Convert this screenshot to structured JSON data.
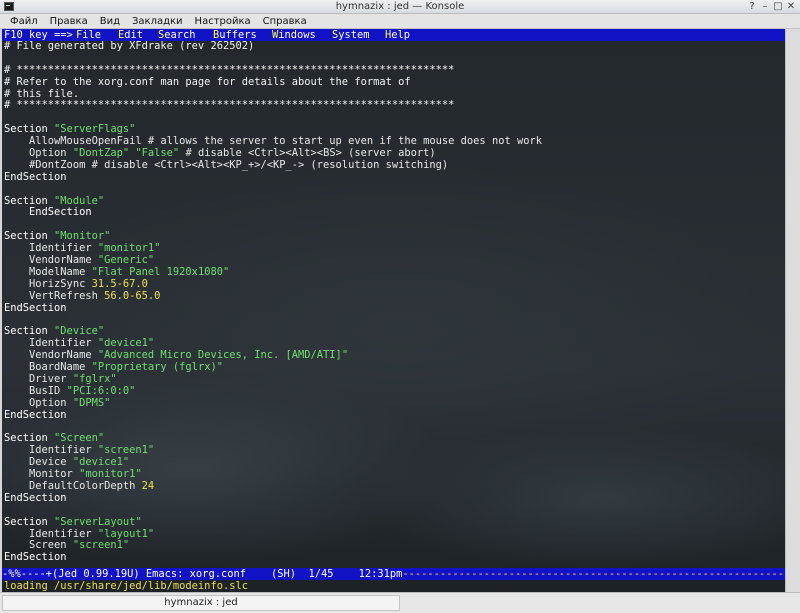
{
  "window": {
    "title": "hymnazix : jed — Konsole",
    "controls": [
      "?",
      "–",
      "□",
      "✕"
    ]
  },
  "menubar": {
    "items": [
      "Файл",
      "Правка",
      "Вид",
      "Закладки",
      "Настройка",
      "Справка"
    ]
  },
  "jed_menu": {
    "prefix": "F10 key ==>",
    "items": [
      {
        "hot": "F",
        "rest": "ile"
      },
      {
        "hot": "E",
        "rest": "dit"
      },
      {
        "hot": "S",
        "rest": "earch"
      },
      {
        "hot": "B",
        "rest": "uffers"
      },
      {
        "hot": "W",
        "rest": "indows"
      },
      {
        "hot": "S",
        "rest": "ystem"
      },
      {
        "hot": "H",
        "rest": "elp"
      }
    ]
  },
  "buffer_lines": [
    [
      [
        "comment",
        "# File generated by XFdrake (rev 262502)"
      ]
    ],
    [],
    [
      [
        "comment",
        "# **********************************************************************"
      ]
    ],
    [
      [
        "comment",
        "# Refer to the xorg.conf man page for details about the format of"
      ]
    ],
    [
      [
        "comment",
        "# this file."
      ]
    ],
    [
      [
        "comment",
        "# **********************************************************************"
      ]
    ],
    [],
    [
      [
        "kw",
        "Section "
      ],
      [
        "str",
        "\"ServerFlags\""
      ]
    ],
    [
      [
        "text",
        "    AllowMouseOpenFail # allows the server to start up even if the mouse does not work"
      ]
    ],
    [
      [
        "text",
        "    Option "
      ],
      [
        "str",
        "\"DontZap\" \"False\""
      ],
      [
        "text",
        " # disable <Ctrl><Alt><BS> (server abort)"
      ]
    ],
    [
      [
        "text",
        "    #DontZoom # disable <Ctrl><Alt><KP_+>/<KP_-> (resolution switching)"
      ]
    ],
    [
      [
        "kw",
        "EndSection"
      ]
    ],
    [],
    [
      [
        "kw",
        "Section "
      ],
      [
        "str",
        "\"Module\""
      ]
    ],
    [
      [
        "kw",
        "    EndSection"
      ]
    ],
    [],
    [
      [
        "kw",
        "Section "
      ],
      [
        "str",
        "\"Monitor\""
      ]
    ],
    [
      [
        "text",
        "    Identifier "
      ],
      [
        "str",
        "\"monitor1\""
      ]
    ],
    [
      [
        "text",
        "    VendorName "
      ],
      [
        "str",
        "\"Generic\""
      ]
    ],
    [
      [
        "text",
        "    ModelName "
      ],
      [
        "str",
        "\"Flat Panel 1920x1080\""
      ]
    ],
    [
      [
        "text",
        "    HorizSync "
      ],
      [
        "num",
        "31.5-67.0"
      ]
    ],
    [
      [
        "text",
        "    VertRefresh "
      ],
      [
        "num",
        "56.0-65.0"
      ]
    ],
    [
      [
        "kw",
        "EndSection"
      ]
    ],
    [],
    [
      [
        "kw",
        "Section "
      ],
      [
        "str",
        "\"Device\""
      ]
    ],
    [
      [
        "text",
        "    Identifier "
      ],
      [
        "str",
        "\"device1\""
      ]
    ],
    [
      [
        "text",
        "    VendorName "
      ],
      [
        "str",
        "\"Advanced Micro Devices, Inc. [AMD/ATI]\""
      ]
    ],
    [
      [
        "text",
        "    BoardName "
      ],
      [
        "str",
        "\"Proprietary (fglrx)\""
      ]
    ],
    [
      [
        "text",
        "    Driver "
      ],
      [
        "str",
        "\"fglrx\""
      ]
    ],
    [
      [
        "text",
        "    BusID "
      ],
      [
        "str",
        "\"PCI:6:0:0\""
      ]
    ],
    [
      [
        "text",
        "    Option "
      ],
      [
        "str",
        "\"DPMS\""
      ]
    ],
    [
      [
        "kw",
        "EndSection"
      ]
    ],
    [],
    [
      [
        "kw",
        "Section "
      ],
      [
        "str",
        "\"Screen\""
      ]
    ],
    [
      [
        "text",
        "    Identifier "
      ],
      [
        "str",
        "\"screen1\""
      ]
    ],
    [
      [
        "text",
        "    Device "
      ],
      [
        "str",
        "\"device1\""
      ]
    ],
    [
      [
        "text",
        "    Monitor "
      ],
      [
        "str",
        "\"monitor1\""
      ]
    ],
    [
      [
        "text",
        "    DefaultColorDepth "
      ],
      [
        "num",
        "24"
      ]
    ],
    [
      [
        "kw",
        "EndSection"
      ]
    ],
    [],
    [
      [
        "kw",
        "Section "
      ],
      [
        "str",
        "\"ServerLayout\""
      ]
    ],
    [
      [
        "text",
        "    Identifier "
      ],
      [
        "str",
        "\"layout1\""
      ]
    ],
    [
      [
        "text",
        "    Screen "
      ],
      [
        "str",
        "\"screen1\""
      ]
    ],
    [
      [
        "kw",
        "EndSection"
      ]
    ]
  ],
  "status_line": {
    "text": "-%%----+(Jed 0.99.19U) Emacs: xorg.conf    (SH)  1/45    12:31pm",
    "fill": "-----------------------------------------------------------------------------------"
  },
  "minibuffer": "loading /usr/share/jed/lib/modeinfo.slc",
  "taskbar": {
    "tab_label": "hymnazix : jed"
  },
  "colors": {
    "menu_bar_blue": "#1212c6",
    "string_green": "#6de06d",
    "number_yellow": "#f0e040"
  }
}
